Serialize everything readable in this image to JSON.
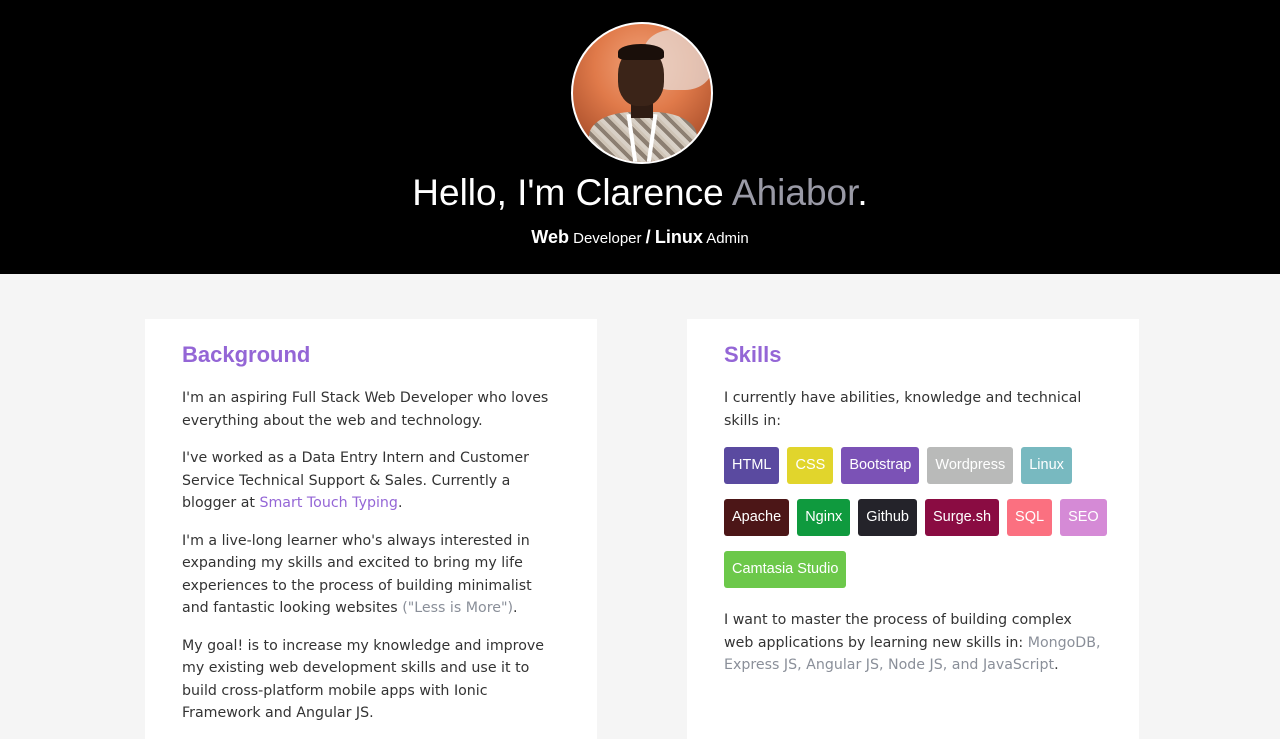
{
  "header": {
    "greeting": "Hello, I'm Clarence ",
    "surname": "Ahiabor",
    "period": ".",
    "role1_strong": "Web",
    "role1_rest": " Developer ",
    "separator": "/",
    "role2_strong": "Linux",
    "role2_rest": " Admin"
  },
  "background": {
    "title": "Background",
    "p1": "I'm an aspiring Full Stack Web Developer who loves everything about the web and technology.",
    "p2_start": "I've worked as a Data Entry Intern and Customer Service Technical Support & Sales. Currently a blogger at ",
    "p2_link": "Smart Touch Typing",
    "p2_end": ".",
    "p3_start": "I'm a live-long learner who's always interested in expanding my skills and excited to bring my life experiences to the process of building minimalist and fantastic looking websites ",
    "p3_quote": "(\"Less is More\")",
    "p3_end": ".",
    "p4": "My goal! is to increase my knowledge and improve my existing web development skills and use it to build cross-platform mobile apps with Ionic Framework and Angular JS."
  },
  "skills": {
    "title": "Skills",
    "intro": "I currently have abilities, knowledge and technical skills in:",
    "badges": [
      {
        "label": "HTML",
        "color": "#5a4aa0"
      },
      {
        "label": "CSS",
        "color": "#e1d52c"
      },
      {
        "label": "Bootstrap",
        "color": "#7b52b6"
      },
      {
        "label": "Wordpress",
        "color": "#b9bab9"
      },
      {
        "label": "Linux",
        "color": "#78b9c0"
      },
      {
        "label": "Apache",
        "color": "#4c1617"
      },
      {
        "label": "Nginx",
        "color": "#0f9a3e"
      },
      {
        "label": "Github",
        "color": "#24232a"
      },
      {
        "label": "Surge.sh",
        "color": "#8a0c42"
      },
      {
        "label": "SQL",
        "color": "#fb7080"
      },
      {
        "label": "SEO",
        "color": "#d58ad6"
      },
      {
        "label": "Camtasia Studio",
        "color": "#6cc84a"
      }
    ],
    "outro_start": "I want to master the process of building complex web applications by learning new skills in: ",
    "outro_tech": "MongoDB, Express JS, Angular JS, Node JS, and JavaScript",
    "outro_end": "."
  }
}
